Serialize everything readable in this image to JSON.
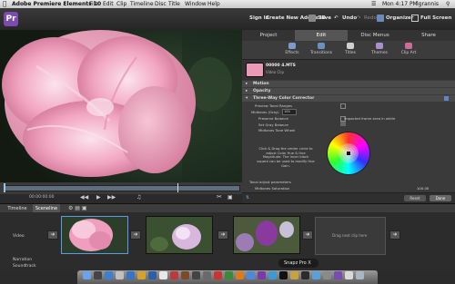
{
  "menubar": {
    "app_name": "Adobe Premiere Elements 10",
    "menus": [
      "File",
      "Edit",
      "Clip",
      "Timeline",
      "Disc",
      "Title",
      "Window",
      "Help"
    ],
    "clock": "Mon 4:17 PM",
    "user": "lgrannis"
  },
  "toolbar": {
    "sign_in": "Sign In",
    "create_account": "Create New Adobe ID",
    "save": "Save",
    "undo": "Undo",
    "redo": "Redo",
    "organizer": "Organizer",
    "full_screen": "Full Screen"
  },
  "tabs": [
    "Project",
    "Edit",
    "Disc Menus",
    "Share"
  ],
  "active_tab": "Edit",
  "subtabs": [
    "Effects",
    "Transitions",
    "Titles",
    "Themes",
    "Clip Art"
  ],
  "clip": {
    "name": "00000 4.MTS",
    "type": "Video Clip"
  },
  "properties": {
    "rows": [
      "Motion",
      "Opacity",
      "Three-Way Color Corrector"
    ],
    "preview_tonal_ranges": "Preview Tonal Ranges",
    "midtones": "Midtones (Gray)",
    "midtones_value": "100",
    "preserve_balance": "Preserve Balance",
    "set_gray_balance": "Set Gray Balance",
    "midtones_tone_wheel": "Midtones Tone Wheel",
    "impacted_area": "Impacted frame area in white",
    "instructions": "Click & Drag the center circle to adjust Color Hue & Hue Magnitude. The inner black square can be used to modify Hue Gain.",
    "tonal_adjust": "Tonal adjust parameters",
    "midtones_saturation": "Midtones Saturation",
    "saturation_value": "100.00"
  },
  "panel_footer": {
    "reset": "Reset",
    "done": "Done"
  },
  "monitor": {
    "timecode": "00:00:00:00"
  },
  "timeline": {
    "tabs": [
      "Timeline",
      "Sceneline"
    ],
    "active_tab": "Sceneline",
    "video_label": "Video",
    "narration_label": "Narration",
    "soundtrack_label": "Soundtrack",
    "drop_placeholder": "Drag next clip here"
  },
  "dock": {
    "tooltip": "Snapz Pro X"
  }
}
